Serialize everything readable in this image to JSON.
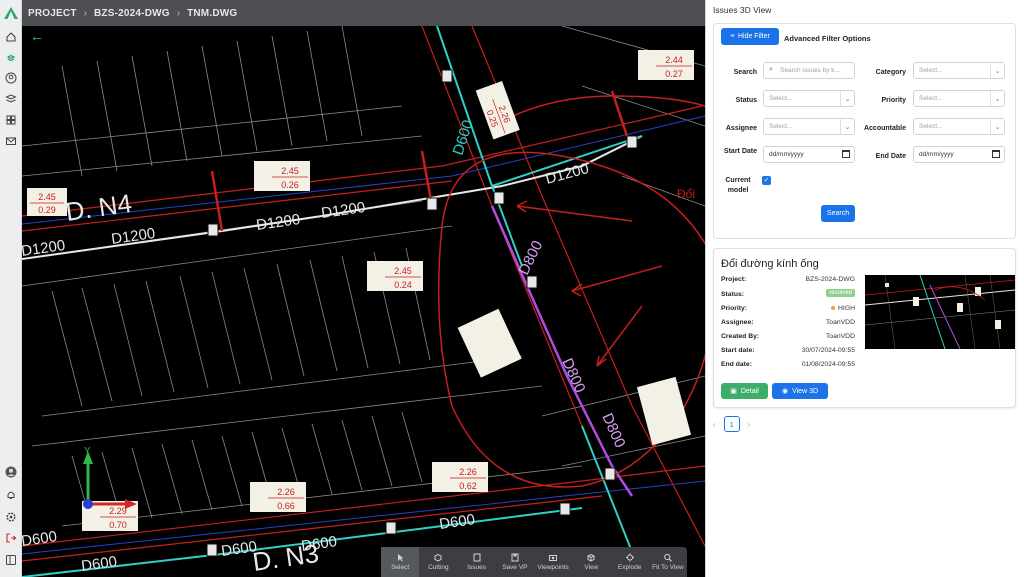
{
  "breadcrumb": {
    "root": "PROJECT",
    "project": "BZS-2024-DWG",
    "file": "TNM.DWG"
  },
  "rail_icons": [
    "home-icon",
    "layers-icon",
    "user-icon",
    "stack-icon",
    "grid-icon",
    "mail-icon",
    "avatar-icon",
    "bell-icon",
    "settings-icon",
    "logout-icon",
    "panel-icon"
  ],
  "cad": {
    "pipe_labels": [
      "D1200",
      "D1200",
      "D1200",
      "D1200",
      "D1200",
      "D600",
      "D600",
      "D600",
      "D600",
      "D800",
      "D800",
      "D800",
      "D600",
      "D600"
    ],
    "lot_labels": [
      "D. N4",
      "D. N3"
    ],
    "axis_y": "Y",
    "depth_tags": [
      [
        "2.45",
        "0.29"
      ],
      [
        "2.45",
        "0.26"
      ],
      [
        "2.45",
        "0.24"
      ],
      [
        "2.26",
        "0.66"
      ],
      [
        "2.26",
        "0.62"
      ],
      [
        "2.26",
        "0.25"
      ],
      [
        "2.29",
        "0.70"
      ],
      [
        "2.44",
        "0.27"
      ]
    ],
    "annotation": "Đổi"
  },
  "toolbar": [
    {
      "label": "Select",
      "icon": "cursor-icon"
    },
    {
      "label": "Cutting",
      "icon": "cube-icon"
    },
    {
      "label": "Issues",
      "icon": "issue-icon"
    },
    {
      "label": "Save VP",
      "icon": "save-icon"
    },
    {
      "label": "Viewpoints",
      "icon": "camera-icon"
    },
    {
      "label": "View",
      "icon": "cube-view-icon"
    },
    {
      "label": "Explode",
      "icon": "explode-icon"
    },
    {
      "label": "Fit To View",
      "icon": "zoom-fit-icon"
    }
  ],
  "panel": {
    "title": "Issues 3D View",
    "hide_filter": "Hide Filter",
    "advanced": "Advanced Filter Options",
    "search_label": "Search",
    "search_placeholder": "Search issues by k...",
    "category_label": "Category",
    "status_label": "Status",
    "priority_label": "Priority",
    "assignee_label": "Assignee",
    "accountable_label": "Accountable",
    "start_label": "Start Date",
    "end_label": "End Date",
    "current_label": "Current model",
    "select_ph": "Select...",
    "date_ph": "dd/mm/yyyy",
    "search_button": "Search"
  },
  "issue": {
    "title": "Đổi đường kính ống",
    "project_label": "Project:",
    "project": "BZS-2024-DWG",
    "status_label": "Status:",
    "status": "resolved",
    "priority_label": "Priority:",
    "priority": "HIGH",
    "assignee_label": "Assignee:",
    "assignee": "ToanVDD",
    "created_label": "Created By:",
    "created": "ToanVDD",
    "start_label": "Start date:",
    "start": "30/07/2024-09:55",
    "end_label": "End date:",
    "end": "01/08/2024-09:55",
    "detail": "Detail",
    "view3d": "View 3D"
  },
  "pagination": {
    "current": "1"
  },
  "colors": {
    "accent": "#1a73e8",
    "success": "#3cae6a",
    "pipe": "#2fd0c6",
    "trunk": "#b04ce0",
    "markup": "#c81e1e"
  }
}
